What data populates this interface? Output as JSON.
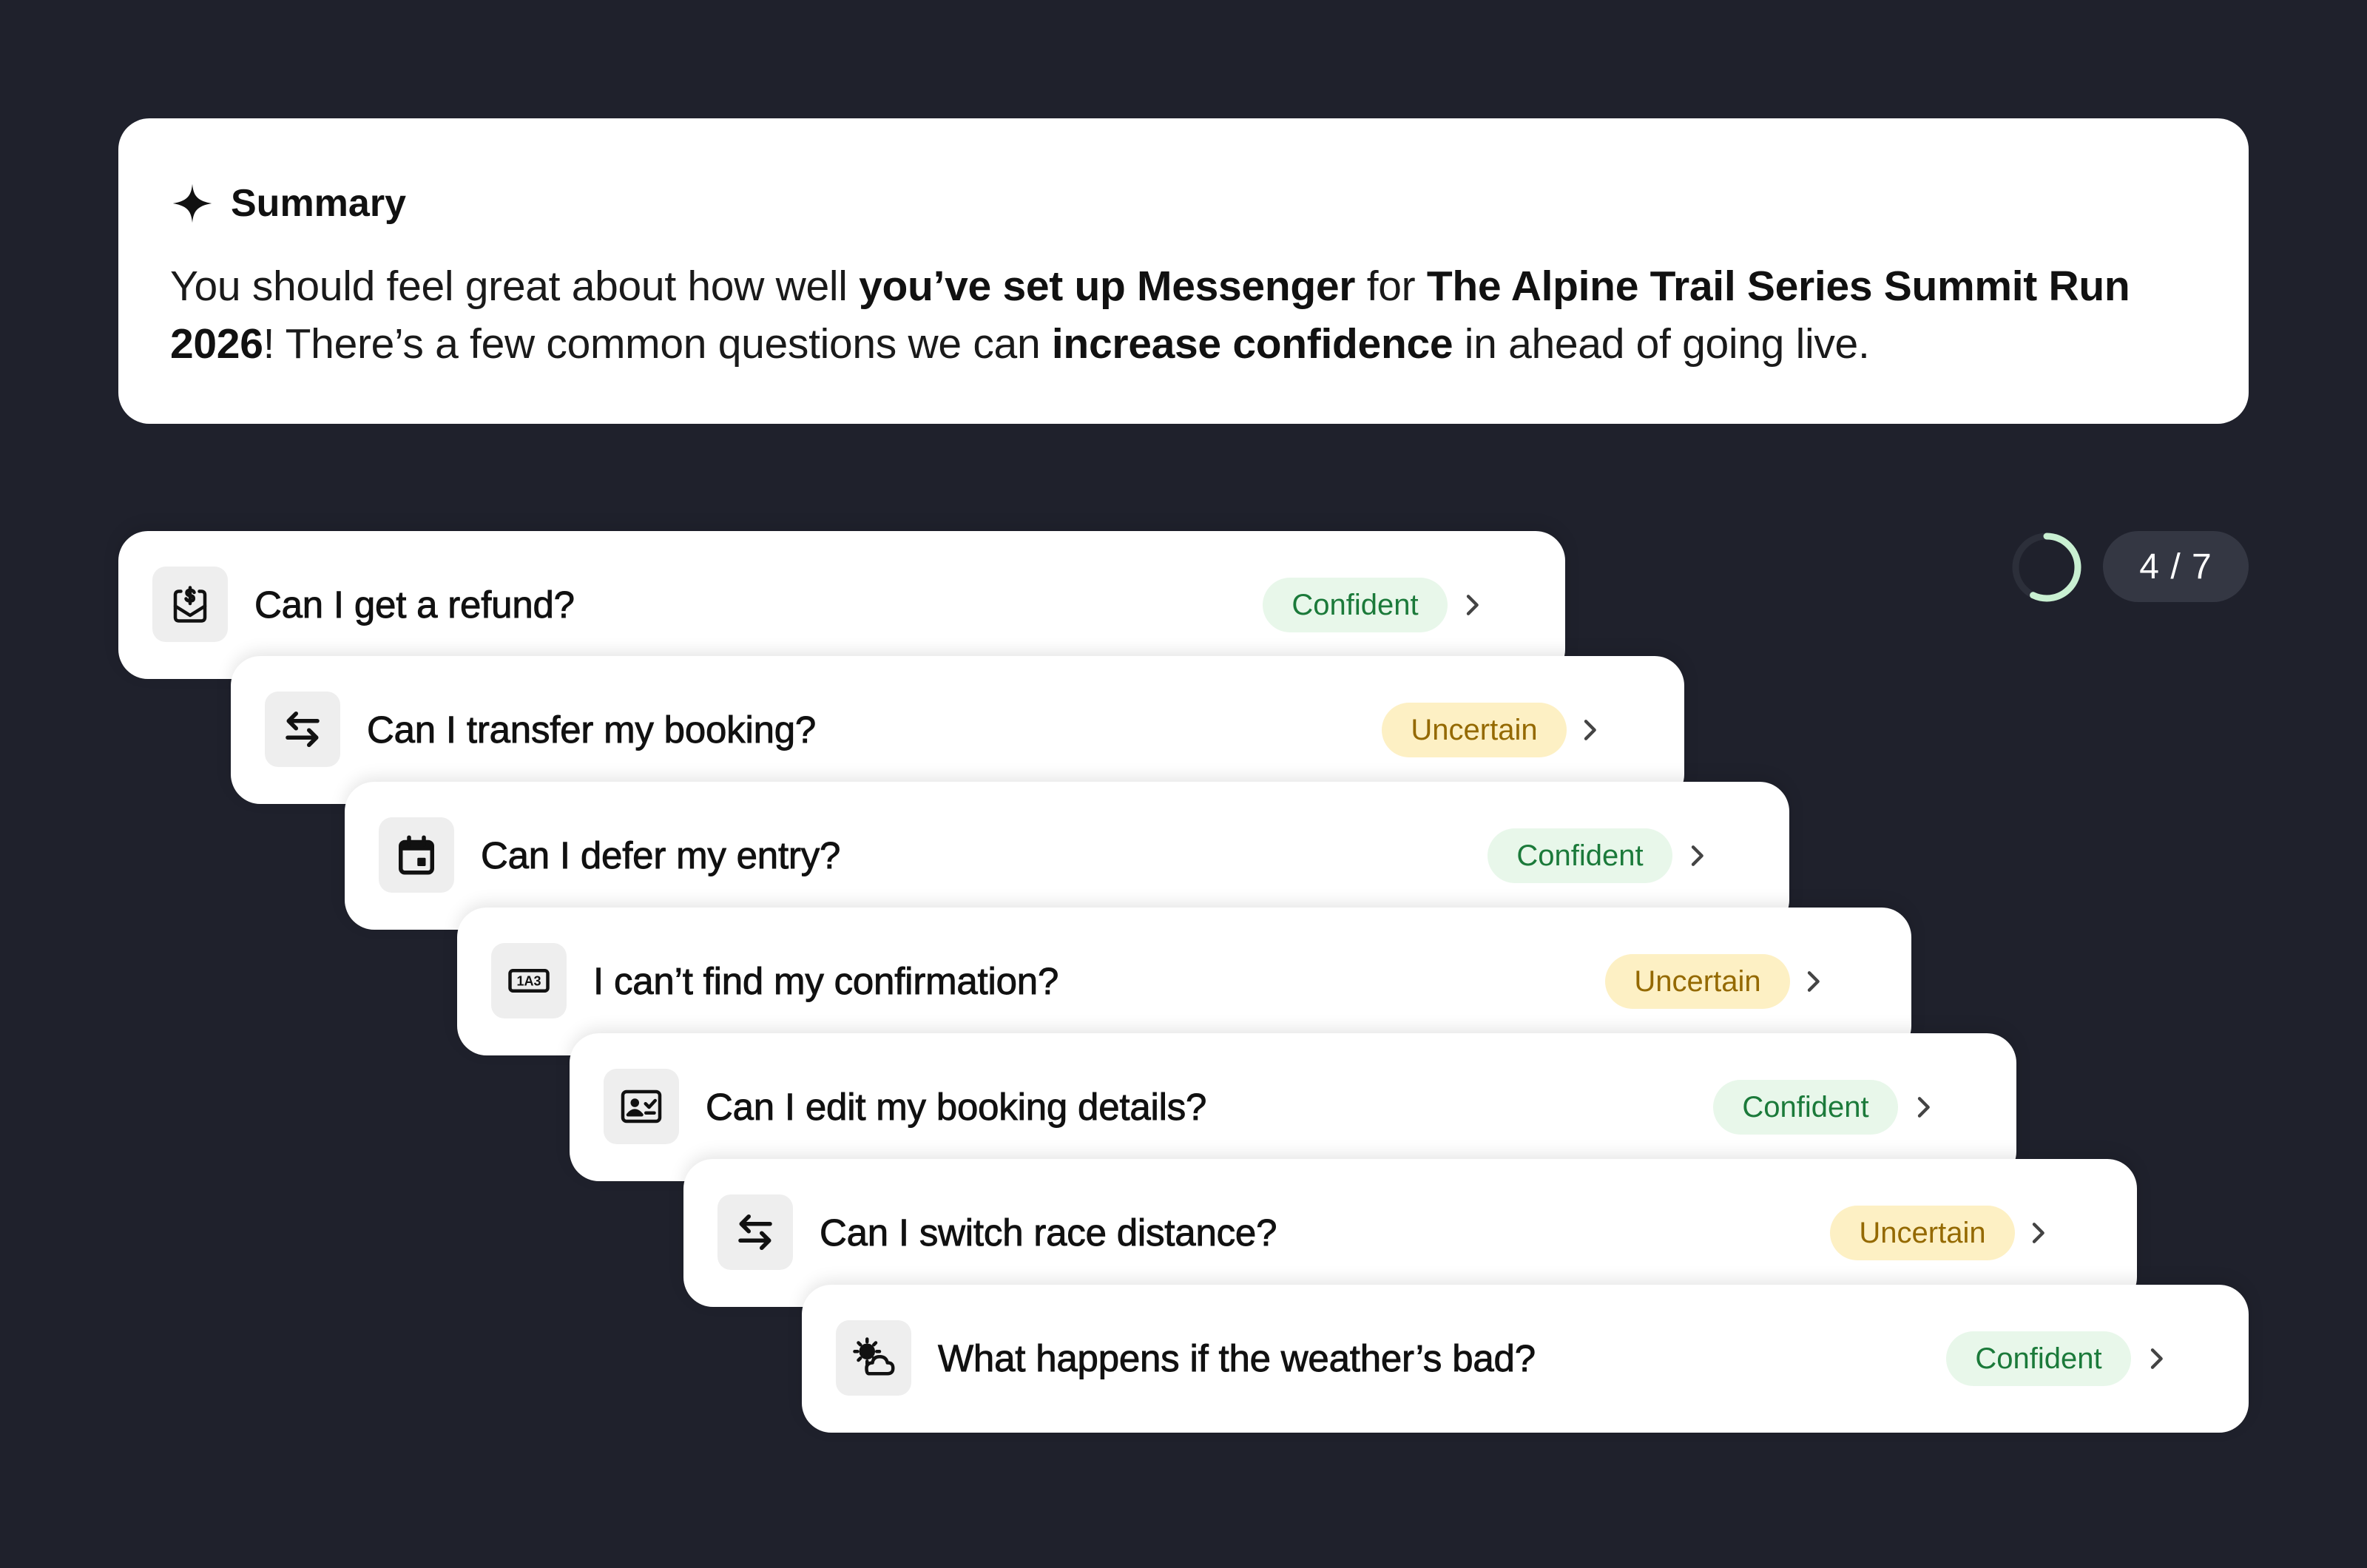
{
  "summary": {
    "title": "Summary",
    "icon": "sparkle-icon",
    "text_1": "You should feel great about how well ",
    "bold_1": "you’ve set up Messenger",
    "text_2": " for ",
    "bold_2": "The Alpine Trail Series Summit Run 2026",
    "text_3": "! There’s a few common questions we can ",
    "bold_3": "increase confidence",
    "text_4": " in ahead of going live."
  },
  "progress": {
    "label": "4 / 7",
    "completed": 4,
    "total": 7
  },
  "colors": {
    "background": "#1f212c",
    "confident_bg": "#e8f7ea",
    "confident_text": "#1b7a3a",
    "uncertain_bg": "#fdf0c4",
    "uncertain_text": "#946900",
    "progress_ring": "#c9f0d2"
  },
  "questions": [
    {
      "label": "Can I get a refund?",
      "status": "Confident",
      "icon": "refund-inbox-icon"
    },
    {
      "label": "Can I transfer my booking?",
      "status": "Uncertain",
      "icon": "transfer-arrows-icon"
    },
    {
      "label": "Can I defer my entry?",
      "status": "Confident",
      "icon": "calendar-icon"
    },
    {
      "label": "I can’t find my confirmation?",
      "status": "Uncertain",
      "icon": "confirmation-code-icon"
    },
    {
      "label": "Can I edit my booking details?",
      "status": "Confident",
      "icon": "id-card-icon"
    },
    {
      "label": "Can I switch race distance?",
      "status": "Uncertain",
      "icon": "transfer-arrows-icon"
    },
    {
      "label": "What happens if the weather’s bad?",
      "status": "Confident",
      "icon": "weather-icon"
    }
  ]
}
